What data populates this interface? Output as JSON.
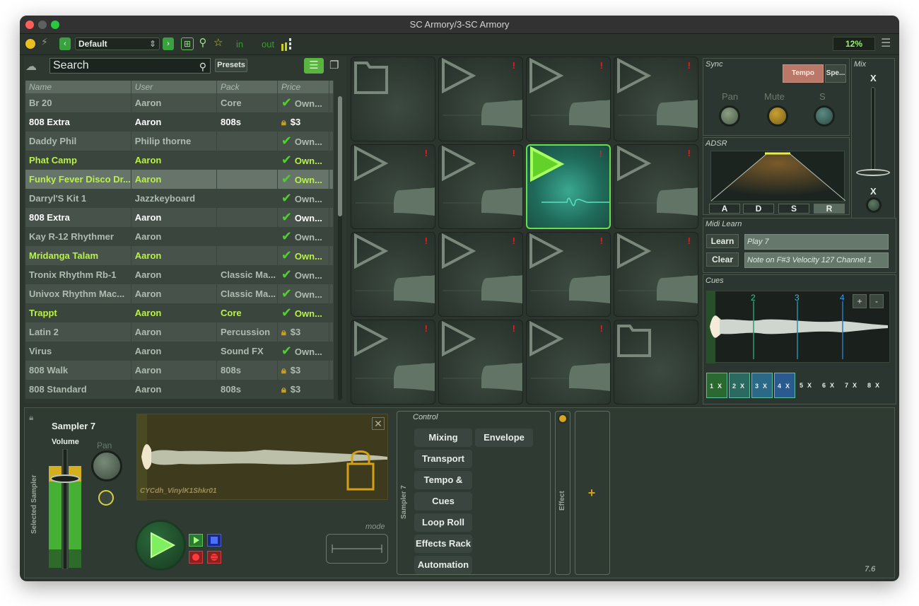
{
  "window": {
    "title": "SC Armory/3-SC Armory"
  },
  "toolbar": {
    "preset": "Default",
    "in_label": "in",
    "out_label": "out",
    "cpu": "12%"
  },
  "browser": {
    "search_placeholder": "Search",
    "presets_label": "Presets",
    "columns": [
      "Name",
      "User",
      "Pack",
      "Price"
    ],
    "rows": [
      {
        "name": "Br 20",
        "user": "Aaron",
        "pack": "Core",
        "price": "Own...",
        "owned": true,
        "style": "g"
      },
      {
        "name": "808 Extra",
        "user": "Aaron",
        "pack": "808s",
        "price": "$3",
        "owned": false,
        "style": "w"
      },
      {
        "name": "Daddy Phil",
        "user": "Philip thorne",
        "pack": "",
        "price": "Own...",
        "owned": true,
        "style": "g"
      },
      {
        "name": "Phat Camp",
        "user": "Aaron",
        "pack": "",
        "price": "Own...",
        "owned": true,
        "style": "l"
      },
      {
        "name": "Funky Fever Disco Dr...",
        "user": "Aaron",
        "pack": "",
        "price": "Own...",
        "owned": true,
        "style": "l"
      },
      {
        "name": "Darryl'S Kit 1",
        "user": "Jazzkeyboard",
        "pack": "",
        "price": "Own...",
        "owned": true,
        "style": "g"
      },
      {
        "name": "808 Extra",
        "user": "Aaron",
        "pack": "",
        "price": "Own...",
        "owned": true,
        "style": "w"
      },
      {
        "name": "Kay R-12 Rhythmer",
        "user": "Aaron",
        "pack": "",
        "price": "Own...",
        "owned": true,
        "style": "g"
      },
      {
        "name": "Mridanga Talam",
        "user": "Aaron",
        "pack": "",
        "price": "Own...",
        "owned": true,
        "style": "l"
      },
      {
        "name": "Tronix Rhythm Rb-1",
        "user": "Aaron",
        "pack": "Classic Ma...",
        "price": "Own...",
        "owned": true,
        "style": "g"
      },
      {
        "name": "Univox Rhythm Mac...",
        "user": "Aaron",
        "pack": "Classic Ma...",
        "price": "Own...",
        "owned": true,
        "style": "g"
      },
      {
        "name": "Trappt",
        "user": "Aaron",
        "pack": "Core",
        "price": "Own...",
        "owned": true,
        "style": "l"
      },
      {
        "name": "Latin 2",
        "user": "Aaron",
        "pack": "Percussion",
        "price": "$3",
        "owned": false,
        "style": "g"
      },
      {
        "name": "Virus",
        "user": "Aaron",
        "pack": "Sound FX",
        "price": "Own...",
        "owned": true,
        "style": "g"
      },
      {
        "name": "808 Walk",
        "user": "Aaron",
        "pack": "808s",
        "price": "$3",
        "owned": false,
        "style": "g"
      },
      {
        "name": "808 Standard",
        "user": "Aaron",
        "pack": "808s",
        "price": "$3",
        "owned": false,
        "style": "g"
      }
    ],
    "selected_row": 4
  },
  "pads": {
    "layout": [
      "folder",
      "sample",
      "sample",
      "sample",
      "sample",
      "sample",
      "active",
      "sample",
      "sample",
      "sample",
      "sample",
      "sample",
      "sample",
      "sample",
      "sample",
      "folder"
    ],
    "warning_mark": "!"
  },
  "sync": {
    "title": "Sync",
    "tempo": "Tempo",
    "speed": "Spe...",
    "pan": "Pan",
    "mute": "Mute",
    "s": "S",
    "accent": "#b97868"
  },
  "mix": {
    "title": "Mix",
    "x_top": "X",
    "x_bottom": "X"
  },
  "adsr": {
    "title": "ADSR",
    "buttons": [
      "A",
      "D",
      "S",
      "R"
    ]
  },
  "midi": {
    "title": "Midi Learn",
    "learn": "Learn",
    "clear": "Clear",
    "play": "Play 7",
    "note": "Note on F#3 Velocity 127 Channel 1"
  },
  "cues": {
    "title": "Cues",
    "markers": [
      "2",
      "3",
      "4"
    ],
    "plus": "+",
    "minus": "-",
    "slots": [
      "1",
      "2",
      "3",
      "4",
      "5",
      "6",
      "7",
      "8"
    ],
    "x": "X"
  },
  "sampler": {
    "side_label": "Selected Sampler",
    "title": "Sampler 7",
    "volume": "Volume",
    "pan": "Pan",
    "filename": "CYCdh_VinylK1Shkr01",
    "mode": "mode",
    "control_title": "Control",
    "control_side": "Sampler 7",
    "controls": [
      "Mixing",
      "Envelope",
      "Transport",
      "Tempo & Key",
      "Cues",
      "Loop Roll",
      "Effects Rack",
      "Automation"
    ],
    "effect_label": "Effect",
    "version": "7.6"
  }
}
